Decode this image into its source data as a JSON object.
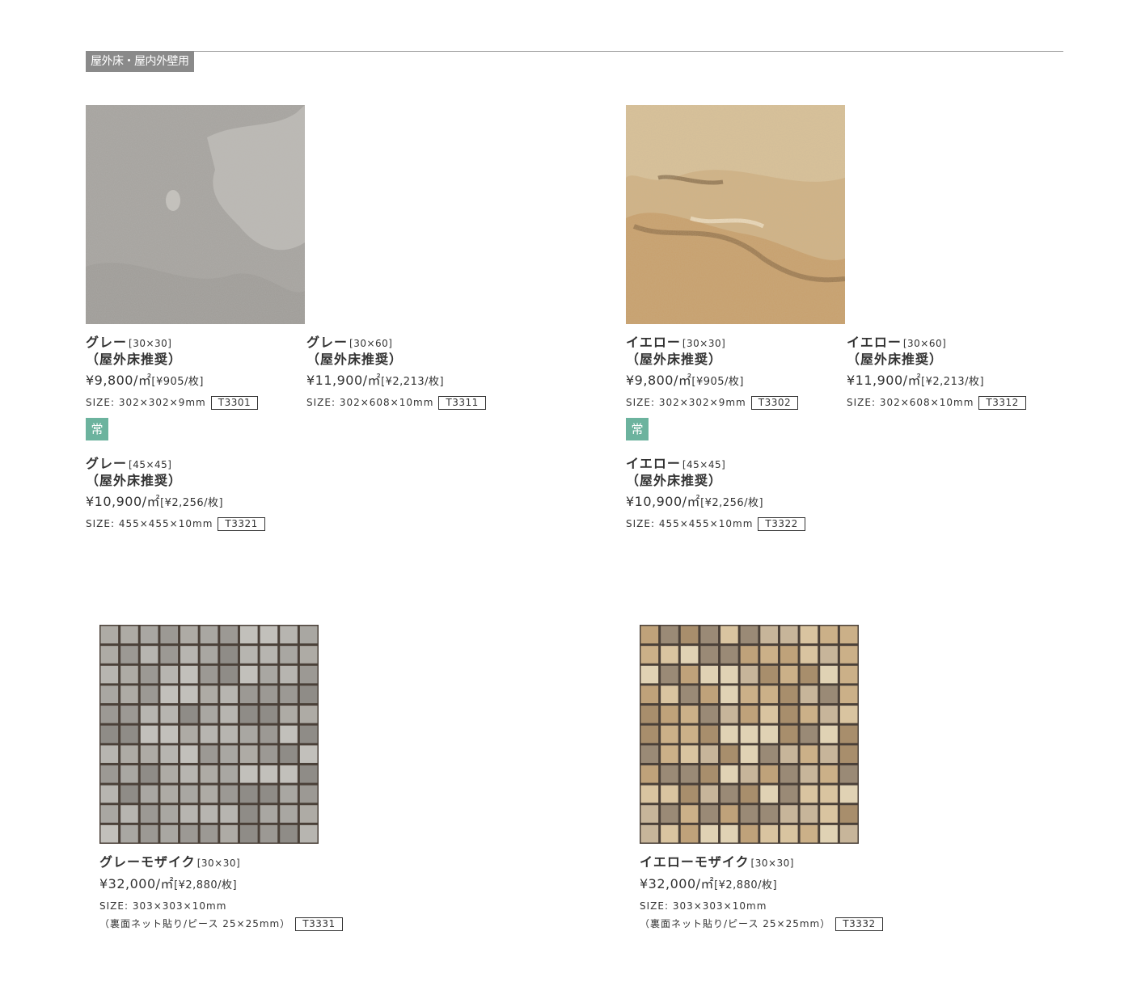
{
  "category": "屋外床・屋内外壁用",
  "left": {
    "tiles": [
      {
        "name": "グレー",
        "dim": "[30×30]",
        "note": "（屋外床推奨）",
        "price": "¥9,800/㎡",
        "per": "[¥905/枚]",
        "size": "SIZE: 302×302×9mm",
        "code": "T3301"
      },
      {
        "name": "グレー",
        "dim": "[30×60]",
        "note": "（屋外床推奨）",
        "price": "¥11,900/㎡",
        "per": "[¥2,213/枚]",
        "size": "SIZE: 302×608×10mm",
        "code": "T3311"
      },
      {
        "name": "グレー",
        "dim": "[45×45]",
        "note": "（屋外床推奨）",
        "price": "¥10,900/㎡",
        "per": "[¥2,256/枚]",
        "size": "SIZE: 455×455×10mm",
        "code": "T3321"
      }
    ],
    "badge": "常",
    "mosaic": {
      "name": "グレーモザイク",
      "dim": "[30×30]",
      "price": "¥32,000/㎡",
      "per": "[¥2,880/枚]",
      "size": "SIZE: 303×303×10mm",
      "note": "（裏面ネット貼り/ピース 25×25mm）",
      "code": "T3331"
    }
  },
  "right": {
    "tiles": [
      {
        "name": "イエロー",
        "dim": "[30×30]",
        "note": "（屋外床推奨）",
        "price": "¥9,800/㎡",
        "per": "[¥905/枚]",
        "size": "SIZE: 302×302×9mm",
        "code": "T3302"
      },
      {
        "name": "イエロー",
        "dim": "[30×60]",
        "note": "（屋外床推奨）",
        "price": "¥11,900/㎡",
        "per": "[¥2,213/枚]",
        "size": "SIZE: 302×608×10mm",
        "code": "T3312"
      },
      {
        "name": "イエロー",
        "dim": "[45×45]",
        "note": "（屋外床推奨）",
        "price": "¥10,900/㎡",
        "per": "[¥2,256/枚]",
        "size": "SIZE: 455×455×10mm",
        "code": "T3322"
      }
    ],
    "badge": "常",
    "mosaic": {
      "name": "イエローモザイク",
      "dim": "[30×30]",
      "price": "¥32,000/㎡",
      "per": "[¥2,880/枚]",
      "size": "SIZE: 303×303×10mm",
      "note": "（裏面ネット貼り/ピース 25×25mm）",
      "code": "T3332"
    }
  },
  "colors": {
    "badge": "#6cb39e",
    "category_bg": "#8a8a8a",
    "gray_tile": "#a7a49f",
    "yellow_tile": "#cfae80"
  }
}
